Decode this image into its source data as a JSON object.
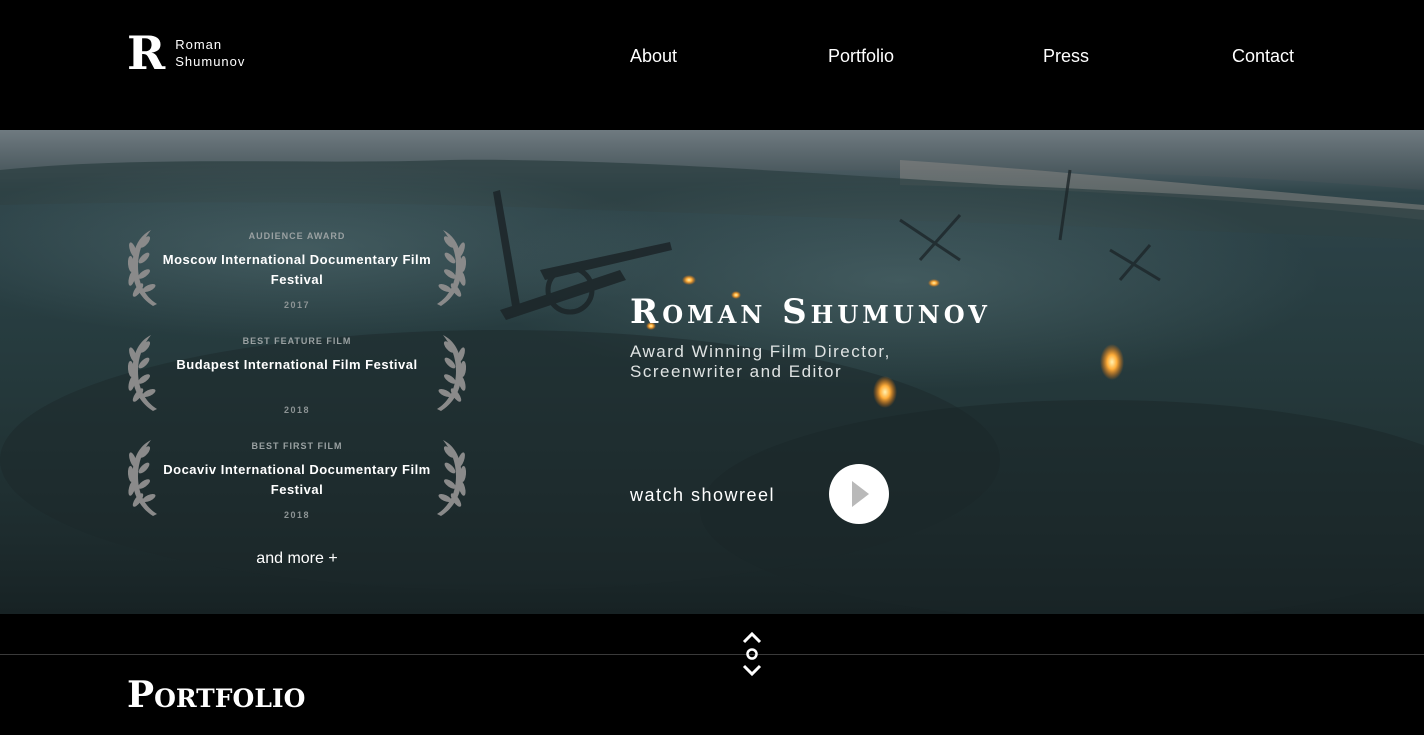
{
  "header": {
    "logo_mark": "R",
    "logo_line1": "Roman",
    "logo_line2": "Shumunov",
    "nav": [
      "About",
      "Portfolio",
      "Press",
      "Contact"
    ]
  },
  "hero": {
    "awards": [
      {
        "category": "Audience Award",
        "name": "Moscow International Documentary Film Festival",
        "year": "2017"
      },
      {
        "category": "Best Feature Film",
        "name": "Budapest International Film Festival",
        "year": "2018"
      },
      {
        "category": "Best First Film",
        "name": "Docaviv International Documentary Film Festival",
        "year": "2018"
      }
    ],
    "and_more": "and more +",
    "title": "Roman Shumunov",
    "subtitle": "Award Winning Film Director, Screenwriter and Editor",
    "showreel_label": "watch showreel"
  },
  "section_title": "Portfolio",
  "colors": {
    "background": "#000000",
    "text": "#ffffff",
    "laurel": "#8a8a8a"
  },
  "icons": {
    "play": "play-icon",
    "laurel": "laurel-icon",
    "scroll_up": "chevron-up-icon",
    "scroll_dot": "circle-icon",
    "scroll_down": "chevron-down-icon"
  }
}
